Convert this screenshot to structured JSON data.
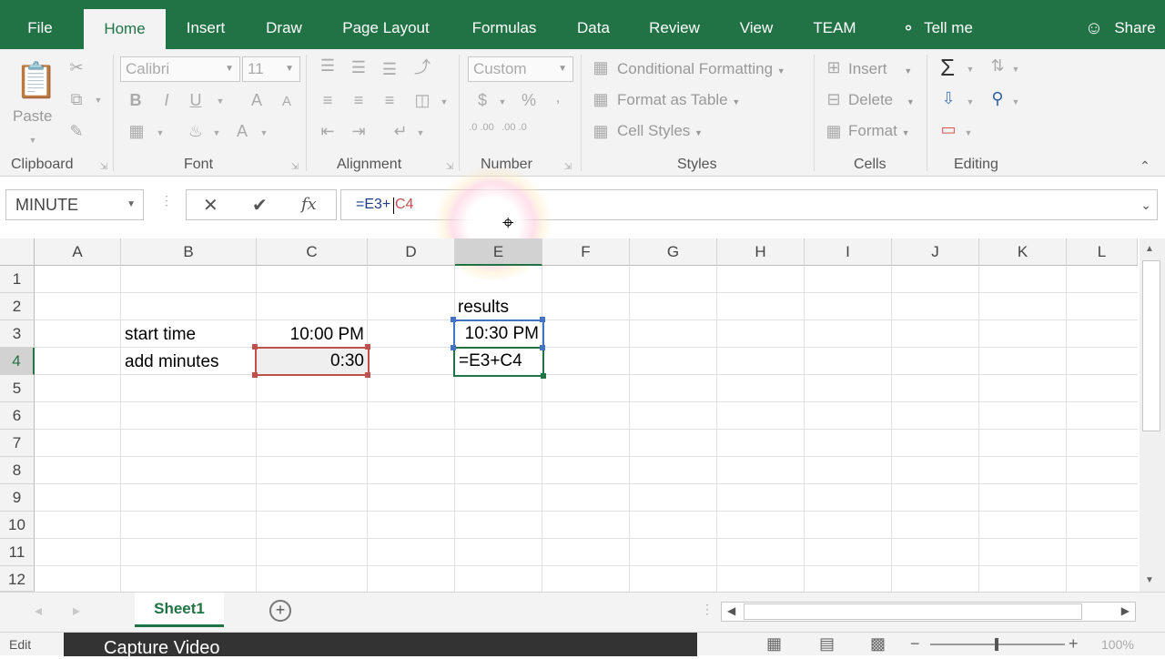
{
  "tabs": [
    "File",
    "Home",
    "Insert",
    "Draw",
    "Page Layout",
    "Formulas",
    "Data",
    "Review",
    "View",
    "TEAM",
    "Tell me",
    "Share"
  ],
  "ribbon": {
    "clipboard": {
      "paste": "Paste",
      "label": "Clipboard"
    },
    "font": {
      "name": "Calibri",
      "size": "11",
      "bold": "B",
      "italic": "I",
      "underline": "U",
      "grow": "A",
      "shrink": "A",
      "color": "A",
      "label": "Font"
    },
    "alignment": {
      "label": "Alignment"
    },
    "number": {
      "format": "Custom",
      "currency": "$",
      "percent": "%",
      "comma": "‚",
      "inc": ".0 .00",
      "dec": ".00 .0",
      "label": "Number"
    },
    "styles": {
      "conditional": "Conditional Formatting",
      "table": "Format as Table",
      "cell": "Cell Styles",
      "label": "Styles"
    },
    "cells": {
      "insert": "Insert",
      "delete": "Delete",
      "format": "Format",
      "label": "Cells"
    },
    "editing": {
      "label": "Editing"
    }
  },
  "formula_bar": {
    "name_box": "MINUTE",
    "fx": "fx",
    "formula_ref1": "=E3+",
    "formula_ref2": "C4"
  },
  "columns": [
    "A",
    "B",
    "C",
    "D",
    "E",
    "F",
    "G",
    "H",
    "I",
    "J",
    "K",
    "L"
  ],
  "rows": [
    "1",
    "2",
    "3",
    "4",
    "5",
    "6",
    "7",
    "8",
    "9",
    "10",
    "11",
    "12"
  ],
  "cells": {
    "E2": "results",
    "B3": "start time",
    "C3": "10:00 PM",
    "E3": "10:30 PM",
    "B4": "add minutes",
    "C4": "0:30",
    "E4": "=E3+C4"
  },
  "sheet_tab": "Sheet1",
  "status": {
    "mode": "Edit",
    "overlay": "Capture Video",
    "zoom": "100%"
  },
  "colors": {
    "brand": "#217346",
    "ref_blue": "#4472c4",
    "ref_red": "#c0504d",
    "active_green": "#217346"
  }
}
